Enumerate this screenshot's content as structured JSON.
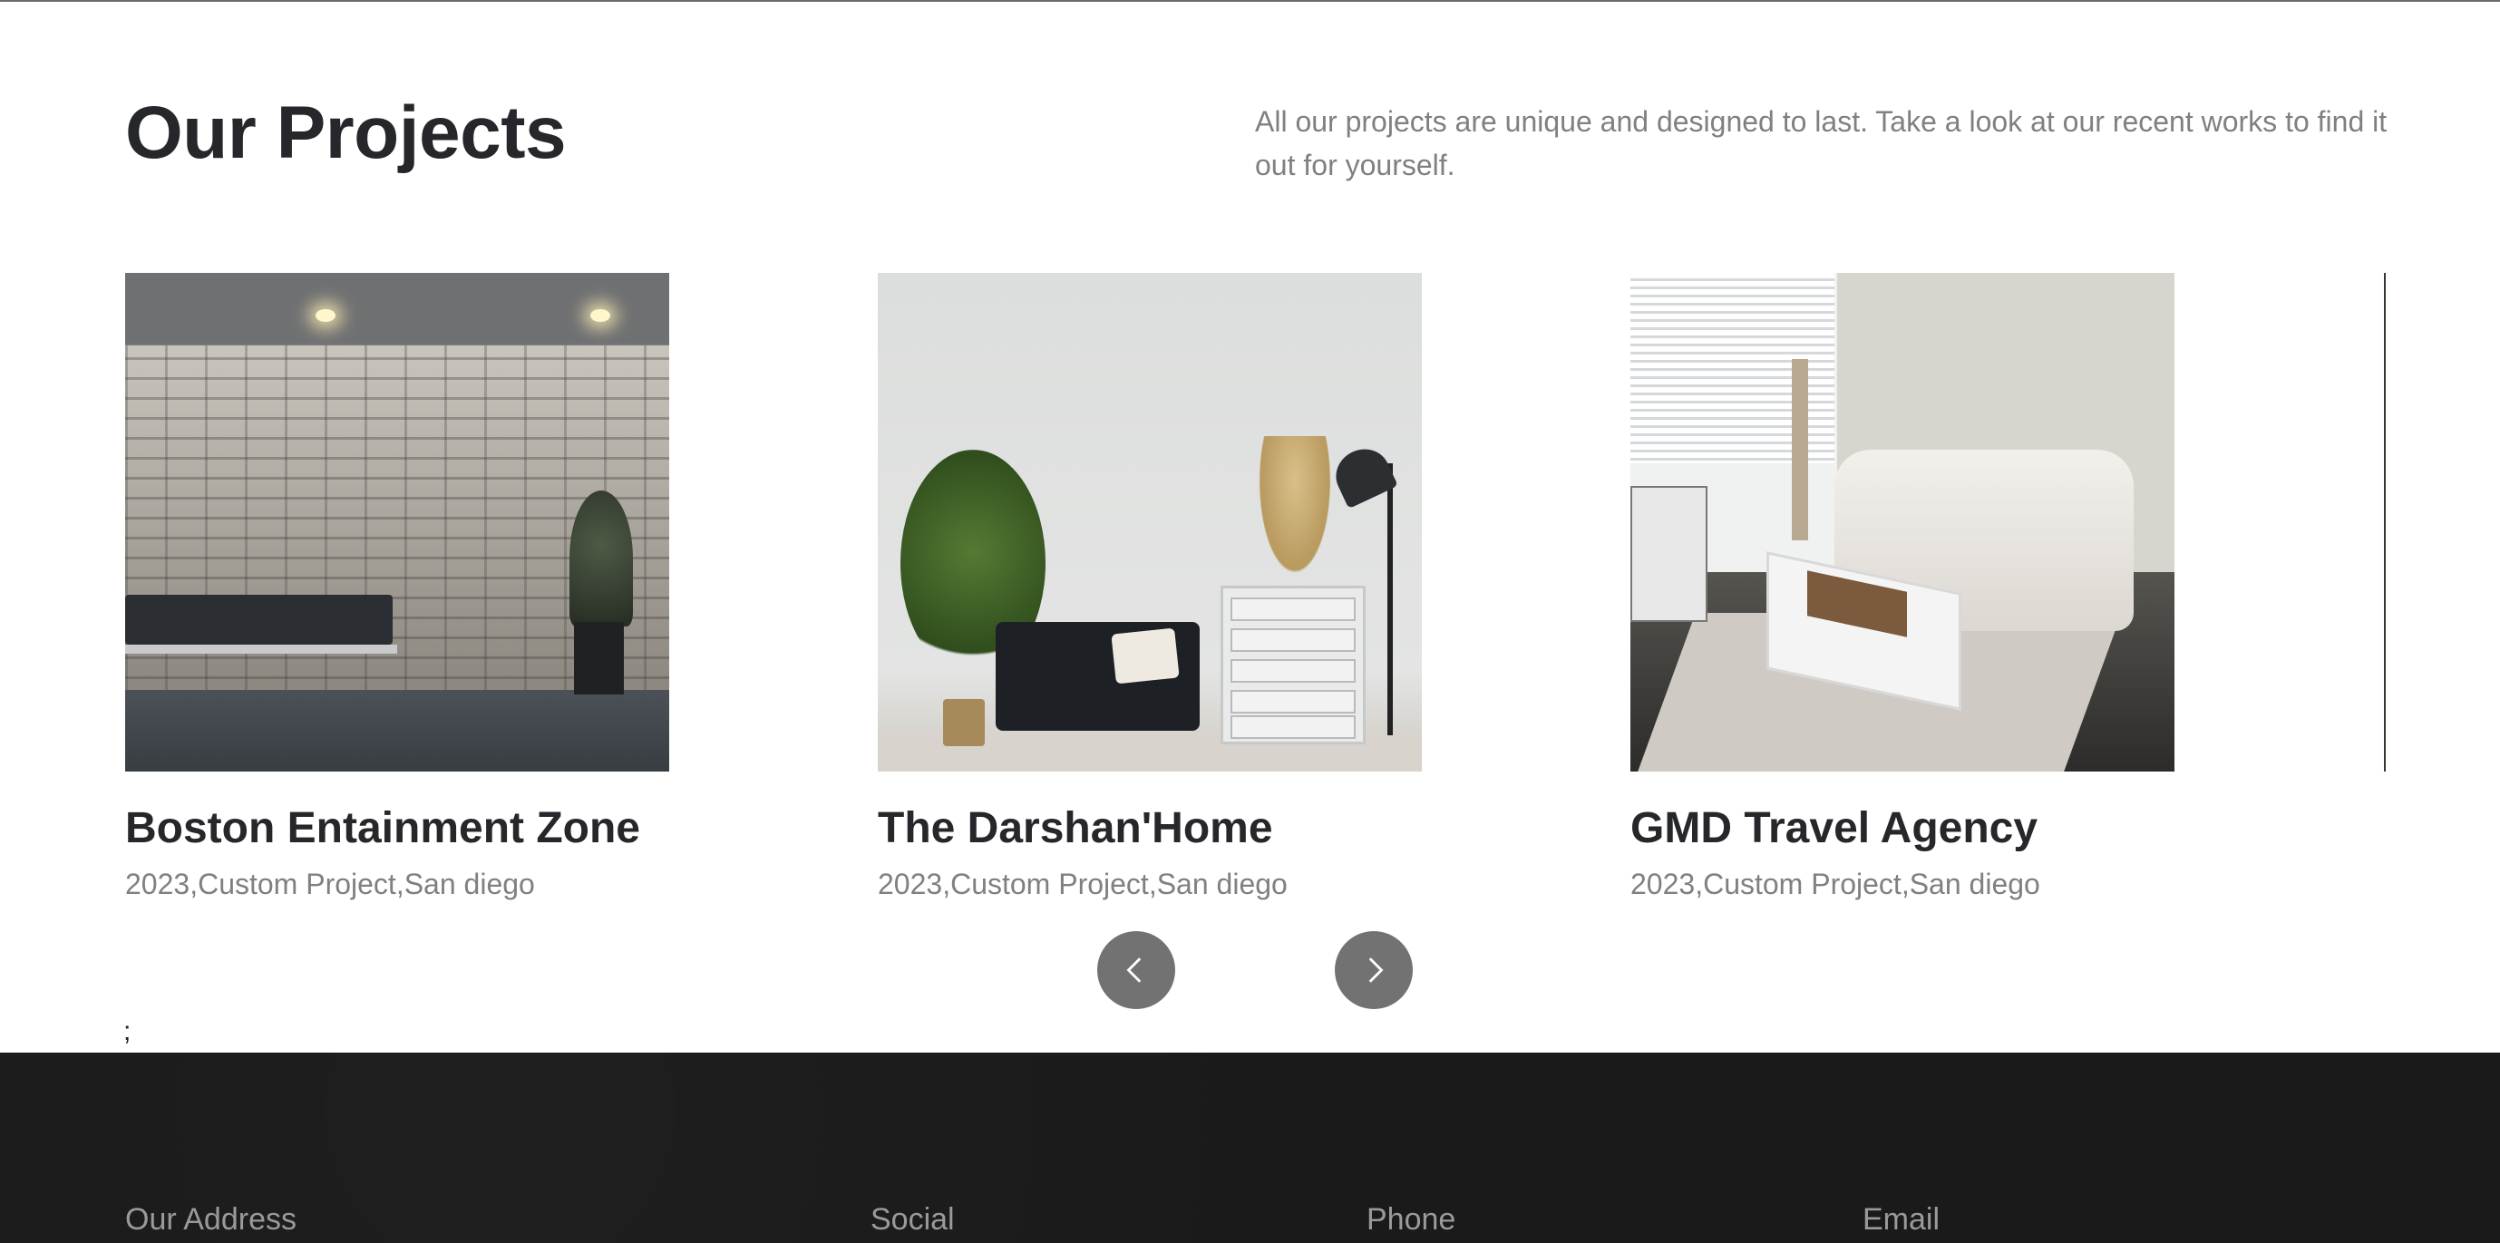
{
  "section": {
    "title": "Our Projects",
    "description": "All our projects are unique and designed to last. Take a look at our recent works to find it out for yourself."
  },
  "projects": [
    {
      "title": "Boston Entainment Zone",
      "meta": "2023,Custom Project,San diego",
      "image_subject": "brick wall lobby with bench"
    },
    {
      "title": "The Darshan'Home",
      "meta": "2023,Custom Project,San diego",
      "image_subject": "living room with black sofa and white dresser"
    },
    {
      "title": "GMD Travel Agency",
      "meta": "2023,Custom Project,San diego",
      "image_subject": "living room with white sofa and coffee table"
    }
  ],
  "carousel": {
    "prev_icon": "chevron-left-icon",
    "next_icon": "chevron-right-icon"
  },
  "stray_text": ";",
  "footer": {
    "headings": [
      "Our Address",
      "Social",
      "Phone",
      "Email"
    ]
  },
  "colors": {
    "heading": "#26272b",
    "muted": "#808080",
    "nav_button": "#727272",
    "footer_bg": "#1a1a1a",
    "footer_heading": "#9a9a9a"
  }
}
